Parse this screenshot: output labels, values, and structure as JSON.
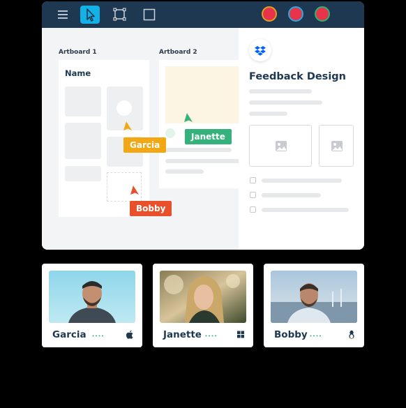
{
  "toolbar": {
    "tools": [
      {
        "icon": "menu-icon"
      },
      {
        "icon": "pointer-icon",
        "active": true
      },
      {
        "icon": "artboard-frame-icon"
      },
      {
        "icon": "rectangle-icon"
      }
    ],
    "participants": [
      {
        "icon": "user-avatar-icon",
        "ring": "#e0a020"
      },
      {
        "icon": "user-avatar-icon",
        "ring": "#27a9e1"
      },
      {
        "icon": "user-avatar-icon",
        "ring": "#2fb374"
      }
    ],
    "colors": {
      "bar": "#1e3851",
      "active_tool": "#13b1e6",
      "avatar": "#e8344a"
    }
  },
  "canvas": {
    "artboard1": {
      "label": "Artboard 1",
      "heading": "Name"
    },
    "artboard2": {
      "label": "Artboard 2"
    }
  },
  "cursors": [
    {
      "name": "Garcia",
      "color": "#f2a814"
    },
    {
      "name": "Janette",
      "color": "#35b27c"
    },
    {
      "name": "Bobby",
      "color": "#e8502b"
    }
  ],
  "panel": {
    "logo": "dropbox-icon",
    "title": "Feedback Design",
    "image_placeholders": [
      "image-icon",
      "image-icon"
    ]
  },
  "collaborators": [
    {
      "name": "Garcia",
      "os": "apple-icon"
    },
    {
      "name": "Janette",
      "os": "windows-icon"
    },
    {
      "name": "Bobby",
      "os": "linux-icon"
    }
  ]
}
